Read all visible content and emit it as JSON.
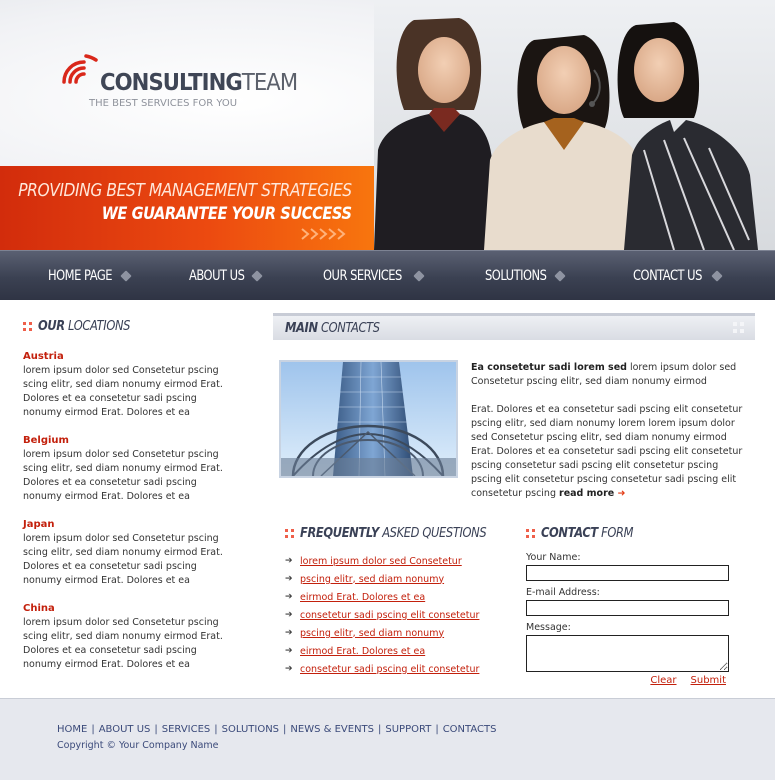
{
  "header": {
    "logo_bold": "CONSULTING",
    "logo_thin": "TEAM",
    "tagline": "THE BEST SERVICES FOR YOU",
    "banner_line1": "PROVIDING BEST MANAGEMENT STRATEGIES",
    "banner_line2": "WE GUARANTEE YOUR SUCCESS"
  },
  "nav": {
    "items": [
      {
        "label": "HOME PAGE"
      },
      {
        "label": "ABOUT US"
      },
      {
        "label": "OUR SERVICES"
      },
      {
        "label": "SOLUTIONS"
      },
      {
        "label": "CONTACT US"
      }
    ]
  },
  "locations": {
    "title_bold": "OUR",
    "title_rest": "LOCATIONS",
    "items": [
      {
        "name": "Austria",
        "text": "lorem ipsum dolor sed Consetetur pscing scing elitr, sed diam nonumy eirmod Erat. Dolores et ea consetetur sadi pscing nonumy eirmod Erat. Dolores et ea"
      },
      {
        "name": "Belgium",
        "text": "lorem ipsum dolor sed Consetetur pscing scing elitr, sed diam nonumy eirmod Erat. Dolores et ea consetetur sadi pscing nonumy eirmod Erat. Dolores et ea"
      },
      {
        "name": "Japan",
        "text": "lorem ipsum dolor sed Consetetur pscing scing elitr, sed diam nonumy eirmod Erat. Dolores et ea consetetur sadi pscing nonumy eirmod Erat. Dolores et ea"
      },
      {
        "name": "China",
        "text": "lorem ipsum dolor sed Consetetur pscing scing elitr, sed diam nonumy eirmod Erat. Dolores et ea consetetur sadi pscing nonumy eirmod Erat. Dolores et ea"
      }
    ]
  },
  "main": {
    "title_bold": "MAIN",
    "title_rest": "CONTACTS",
    "lead_bold": "Ea consetetur sadi lorem sed",
    "lead_rest": " lorem ipsum dolor sed Consetetur pscing elitr, sed diam nonumy eirmod",
    "body": "Erat. Dolores et ea consetetur sadi pscing elit consetetur pscing elitr, sed diam nonumy lorem  lorem ipsum dolor sed Consetetur pscing elitr, sed diam nonumy eirmod Erat. Dolores et ea consetetur sadi pscing elit consetetur pscing consetetur sadi pscing elit consetetur pscing pscing elit consetetur pscing consetetur sadi pscing elit consetetur pscing ",
    "read_more": "read more"
  },
  "faq": {
    "title_bold": "FREQUENTLY",
    "title_rest": "ASKED QUESTIONS",
    "items": [
      "lorem ipsum dolor sed Consetetur",
      "pscing elitr, sed diam nonumy",
      "eirmod Erat. Dolores et ea",
      "consetetur sadi pscing elit consetetur",
      "pscing elitr, sed diam nonumy",
      "eirmod Erat. Dolores et ea",
      "consetetur sadi pscing elit consetetur"
    ]
  },
  "form": {
    "title_bold": "CONTACT",
    "title_rest": "FORM",
    "name_label": "Your Name:",
    "email_label": "E-mail Address:",
    "message_label": "Message:",
    "clear_label": "Clear",
    "submit_label": "Submit"
  },
  "footer": {
    "links": [
      "HOME",
      "ABOUT US",
      "SERVICES",
      "SOLUTIONS",
      "NEWS & EVENTS",
      "SUPPORT",
      "CONTACTS"
    ],
    "copyright": "Copyright © Your Company Name"
  },
  "colors": {
    "accent_red": "#c3200c",
    "banner_orange": "#ec4a10",
    "nav_dark": "#3b4152",
    "footer_link": "#3b4a7a"
  }
}
